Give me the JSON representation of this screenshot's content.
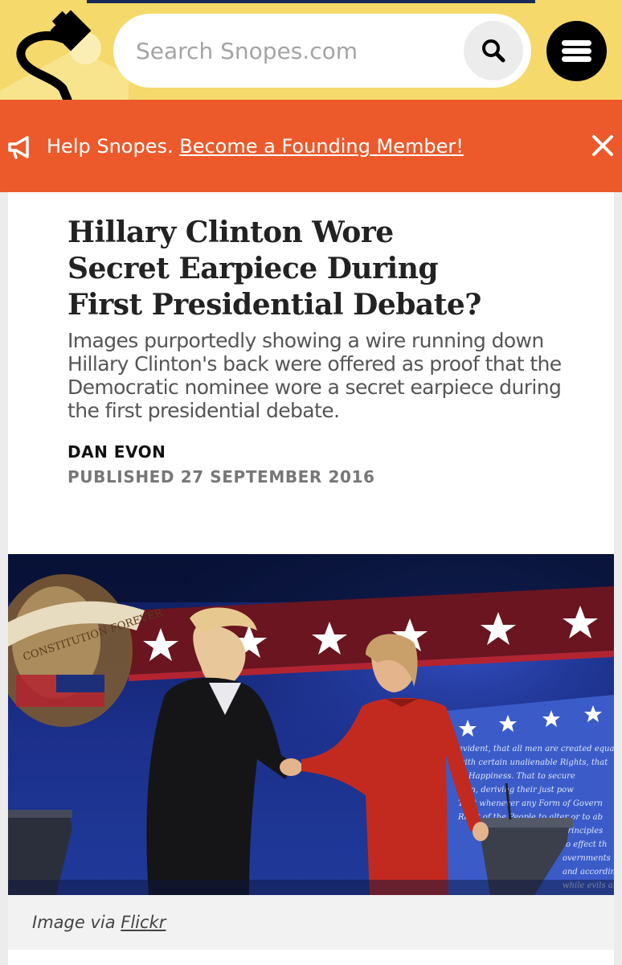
{
  "search": {
    "placeholder": "Search Snopes.com"
  },
  "icons": {
    "logo": "snopes-logo-icon",
    "search": "search-icon",
    "menu": "hamburger-menu-icon",
    "banner": "megaphone-icon",
    "close": "close-icon"
  },
  "colors": {
    "header_bg": "#f5d96a",
    "banner_bg": "#ec5a2c",
    "text_dark": "#222222",
    "text_muted": "#777777"
  },
  "banner": {
    "lead": "Help Snopes.",
    "link": "Become a Founding Member!"
  },
  "article": {
    "title": "Hillary Clinton Wore Secret Earpiece During First Presidential Debate?",
    "subtitle": "Images purportedly showing a wire running down Hillary Clinton's back were offered as proof that the Democratic nominee wore a secret earpiece during the first presidential debate.",
    "author": "DAN EVON",
    "published": "PUBLISHED 27 SEPTEMBER 2016"
  },
  "image": {
    "caption_prefix": "Image via",
    "caption_link": "Flickr",
    "banner_text": "CONSTITUTION FOREVER",
    "backdrop_text": "evident, that all men are created equal, with certain unalienable Rights, that among these are Life, Liberty and the pursuit of Happiness."
  }
}
